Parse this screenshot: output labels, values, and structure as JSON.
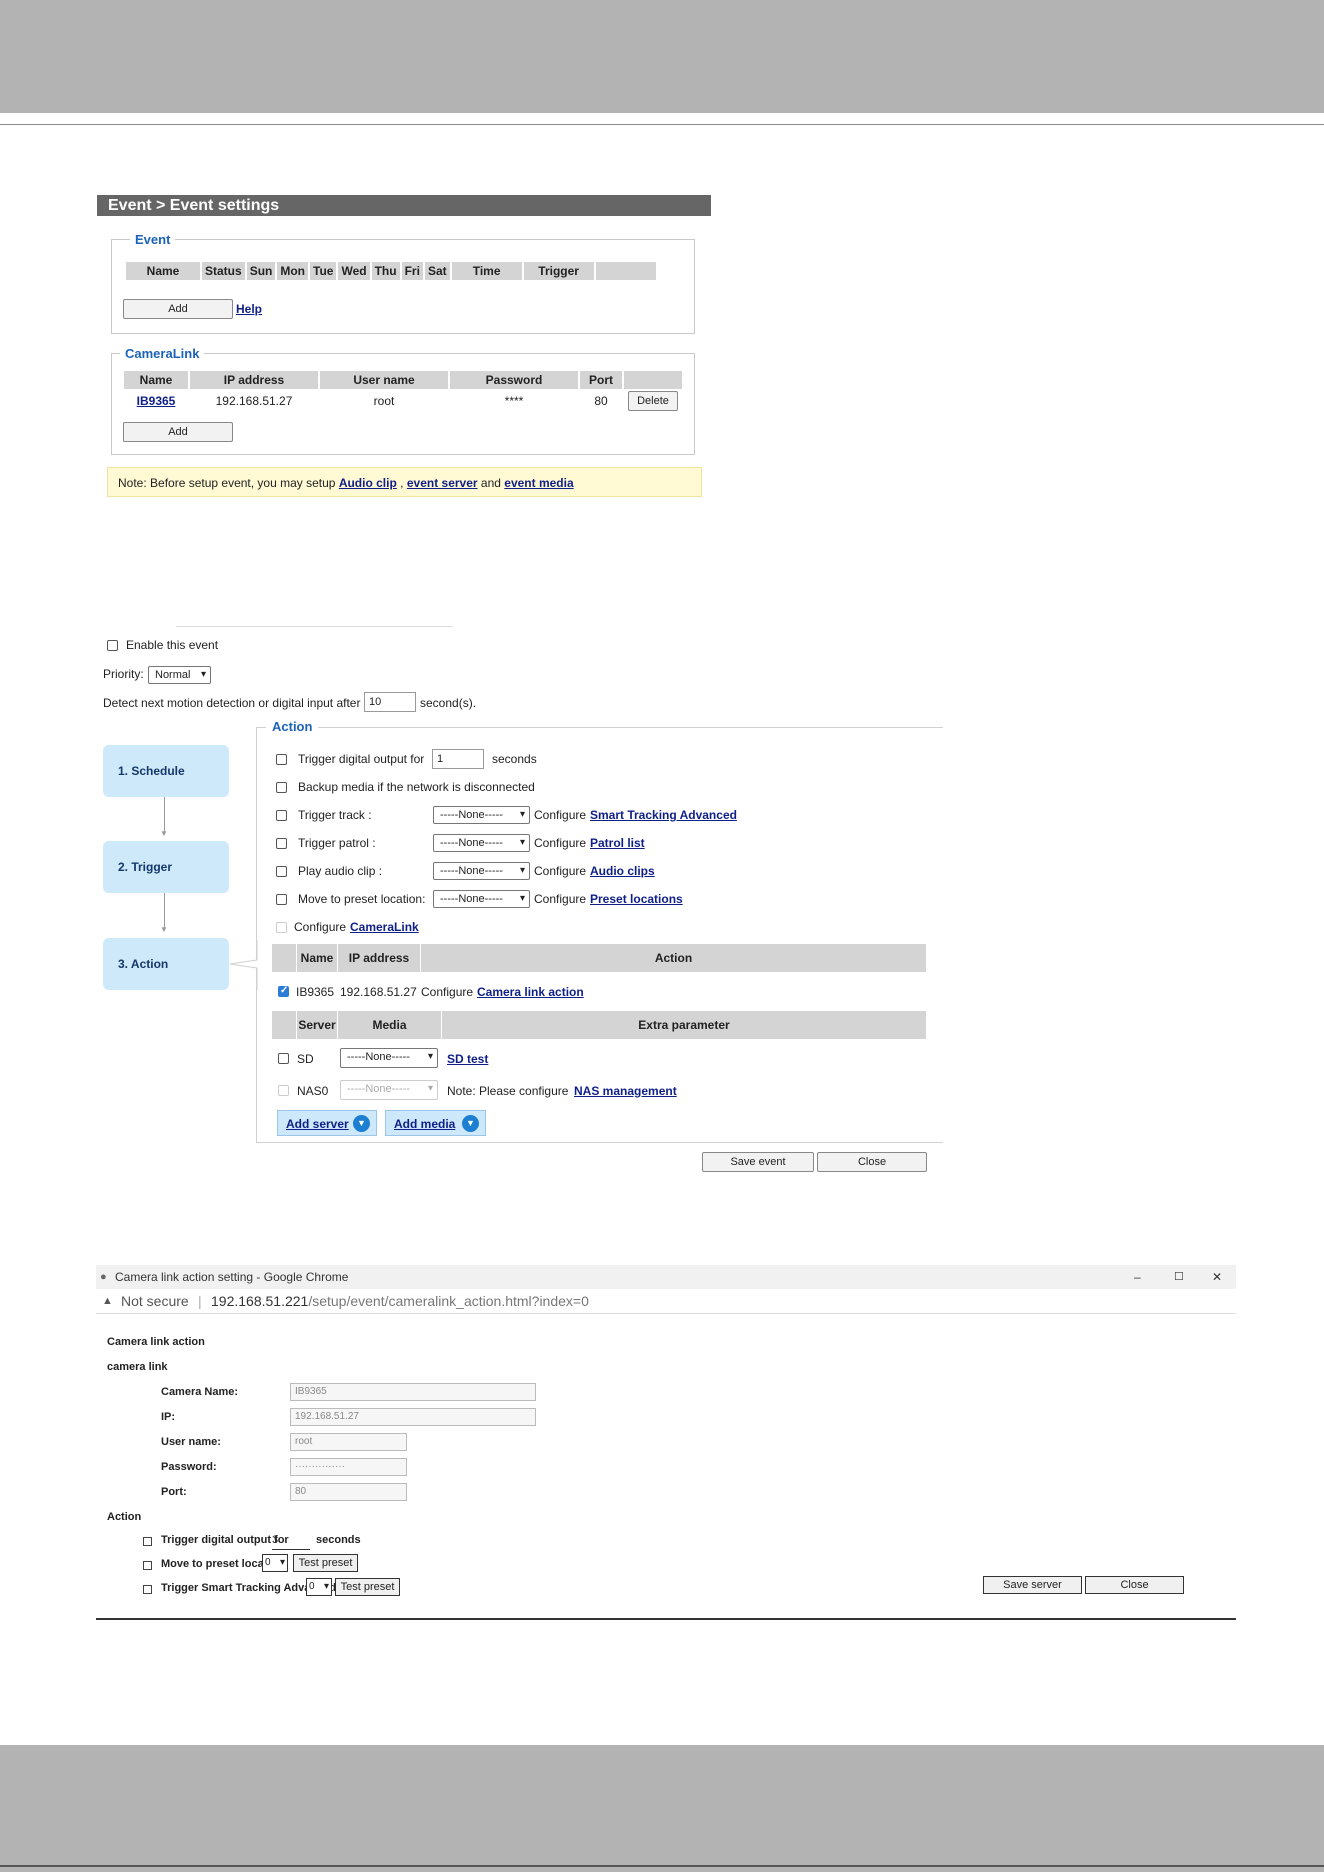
{
  "event_list": {
    "breadcrumb": "Event  > Event settings",
    "event_legend": "Event",
    "event_columns": [
      "Name",
      "Status",
      "Sun",
      "Mon",
      "Tue",
      "Wed",
      "Thu",
      "Fri",
      "Sat",
      "Time",
      "Trigger",
      ""
    ],
    "add_label": "Add",
    "help_label": "Help",
    "cameralink_legend": "CameraLink",
    "cameralink_columns": [
      "Name",
      "IP address",
      "User name",
      "Password",
      "Port",
      ""
    ],
    "cameralink_row": {
      "name": "IB9365",
      "ip": "192.168.51.27",
      "user": "root",
      "password": "****",
      "port": "80",
      "delete": "Delete"
    },
    "add2_label": "Add",
    "note_prefix": "Note: Before setup event, you may setup",
    "note_link1": "Audio clip",
    "note_sep": ",",
    "note_link2": "event server",
    "note_and": "and",
    "note_link3": "event media"
  },
  "event_edit": {
    "enable_label": "Enable this event",
    "priority_label": "Priority:",
    "priority_value": "Normal",
    "detect_label": "Detect next motion detection or digital input after",
    "detect_value": "10",
    "detect_unit": "second(s).",
    "action_legend": "Action",
    "steps": [
      "1.  Schedule",
      "2.  Trigger",
      "3.  Action"
    ],
    "actions": [
      {
        "label": "Trigger digital output for",
        "value": "1",
        "suffix": "seconds"
      },
      {
        "label": "Backup media if the network is disconnected"
      },
      {
        "label": "Trigger track  :",
        "select": "-----None-----",
        "cfg": "Configure",
        "link": "Smart Tracking Advanced"
      },
      {
        "label": "Trigger patrol :",
        "select": "-----None-----",
        "cfg": "Configure",
        "link": "Patrol list"
      },
      {
        "label": "Play audio clip :",
        "select": "-----None-----",
        "cfg": "Configure",
        "link": "Audio clips"
      },
      {
        "label": "Move to preset location:",
        "select": "-----None-----",
        "cfg": "Configure",
        "link": "Preset locations"
      }
    ],
    "configure_cameralink": "Configure",
    "cameralink_link": "CameraLink",
    "cl_head": {
      "name": "Name",
      "ip": "IP address",
      "action": "Action"
    },
    "cl_row": {
      "name": "IB9365",
      "ip": "192.168.51.27",
      "cfg": "Configure",
      "link": "Camera link action"
    },
    "srv_head": {
      "server": "Server",
      "media": "Media",
      "extra": "Extra parameter"
    },
    "srv_rows": [
      {
        "server": "SD",
        "media": "-----None-----",
        "link": "SD test"
      },
      {
        "server": "NAS0",
        "media": "-----None-----",
        "note": "Note: Please configure",
        "link": "NAS management"
      }
    ],
    "add_server": "Add server",
    "add_media": "Add media",
    "save_event": "Save event",
    "close": "Close"
  },
  "popup": {
    "window_title": "Camera link action setting - Google Chrome",
    "minimize": "–",
    "maximize": "☐",
    "close_x": "✕",
    "not_secure": "Not secure",
    "url_host": "192.168.51.221",
    "url_path": "/setup/event/cameralink_action.html?index=0",
    "heading": "Camera link action",
    "section_camera": "camera link",
    "fields": [
      {
        "label": "Camera Name:",
        "value": "IB9365"
      },
      {
        "label": "IP:",
        "value": "192.168.51.27"
      },
      {
        "label": "User name:",
        "value": "root"
      },
      {
        "label": "Password:",
        "value": "···············"
      },
      {
        "label": "Port:",
        "value": "80"
      }
    ],
    "section_action": "Action",
    "act1_label": "Trigger digital output for",
    "act1_value": "3",
    "act1_suffix": "seconds",
    "act2_label": "Move to preset location:",
    "act2_value": "0",
    "act3_label": "Trigger Smart Tracking Advanced:",
    "act3_value": "0",
    "test_preset": "Test preset",
    "save_server": "Save server",
    "close": "Close"
  },
  "icons": {
    "chevron": "▾",
    "dropdown": "▼",
    "warning": "▲",
    "globe": "●"
  }
}
